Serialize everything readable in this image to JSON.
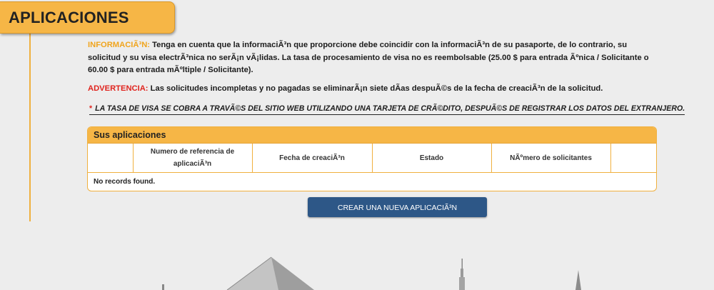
{
  "header": {
    "title": "APLICACIONES"
  },
  "info": {
    "label": "INFORMACIÃ³N:",
    "text": " Tenga en cuenta que la informaciÃ³n que proporcione debe coincidir con la informaciÃ³n de su pasaporte, de lo contrario, su solicitud y su visa electrÃ³nica no serÃ¡n vÃ¡lidas. La tasa de procesamiento de visa no es reembolsable (25.00 $ para entrada Ãºnica / Solicitante o 60.00 $ para entrada mÃºltiple / Solicitante)."
  },
  "warning": {
    "label": "ADVERTENCIA:",
    "text": " Las solicitudes incompletas y no pagadas se eliminarÃ¡n siete dÃ­as despuÃ©s de la fecha de creaciÃ³n de la solicitud."
  },
  "notice": {
    "marker": "*",
    "text": "LA TASA DE VISA SE COBRA A TRAVÃ©S DEL SITIO WEB UTILIZANDO UNA TARJETA DE CRÃ©DITO, DESPUÃ©S DE REGISTRAR LOS DATOS DEL EXTRANJERO."
  },
  "applications": {
    "title": "Sus aplicaciones",
    "columns": [
      "",
      "Numero de referencia de aplicaciÃ³n",
      "Fecha de creaciÃ³n",
      "Estado",
      "NÃºmero de solicitantes",
      ""
    ],
    "empty_message": "No records found."
  },
  "actions": {
    "create_label": "CREAR UNA NUEVA APLICACIÃ³N"
  },
  "colors": {
    "accent": "#f6b646",
    "button": "#2d5787",
    "info_label": "#f0a41c",
    "warning_label": "#e0241e",
    "background": "#ededed"
  }
}
